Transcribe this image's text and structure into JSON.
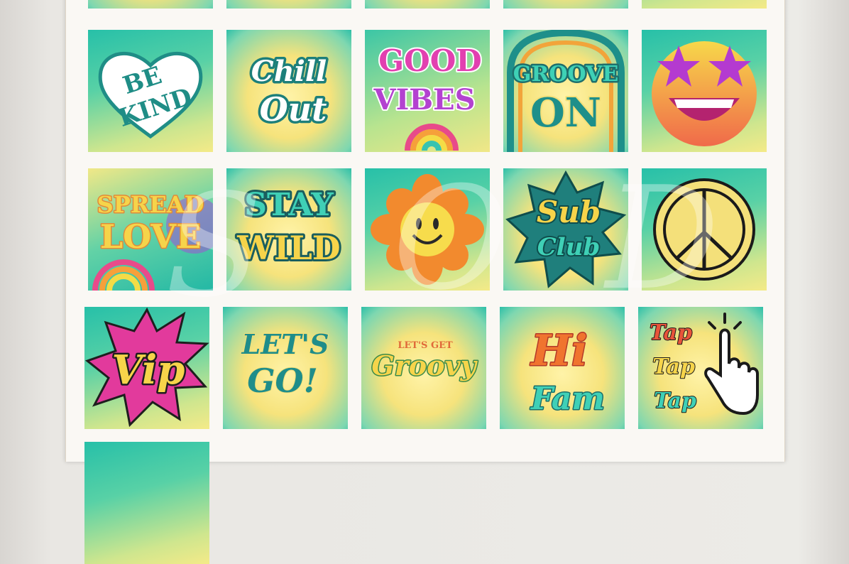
{
  "stickers": [
    {
      "text": "BE KIND"
    },
    {
      "text": "Chill Out"
    },
    {
      "text": "GOOD VIBES"
    },
    {
      "text": "GROOVE ON"
    },
    {
      "text": "star-eyes-emoji"
    },
    {
      "text": "SPREAD LOVE"
    },
    {
      "text": "STAY WILD"
    },
    {
      "text": "smiley-flower"
    },
    {
      "text": "Sub Club"
    },
    {
      "text": "peace-sign"
    },
    {
      "text": "Vip"
    },
    {
      "text": "LET'S GO!"
    },
    {
      "text": "LET'S GET Groovy"
    },
    {
      "text": "Hi Fam"
    },
    {
      "text": "Tap Tap Tap"
    }
  ],
  "words": {
    "be": "BE",
    "kind": "KIND",
    "chill": "Chill",
    "out": "Out",
    "good": "GOOD",
    "vibes": "VIBES",
    "groove": "GROOVE",
    "on": "ON",
    "spread": "SPREAD",
    "love": "LOVE",
    "stay": "STAY",
    "wild": "WILD",
    "sub": "Sub",
    "club": "Club",
    "vip": "Vip",
    "lets": "LET'S",
    "go": "GO!",
    "letsget": "LET'S GET",
    "groovy": "Groovy",
    "hi": "Hi",
    "fam": "Fam",
    "tap": "Tap"
  },
  "colors": {
    "teal": "#1f9e8f",
    "yellow": "#f6e27a",
    "pink": "#e53a9b",
    "orange": "#f07a3a",
    "purple": "#a23fc2"
  }
}
